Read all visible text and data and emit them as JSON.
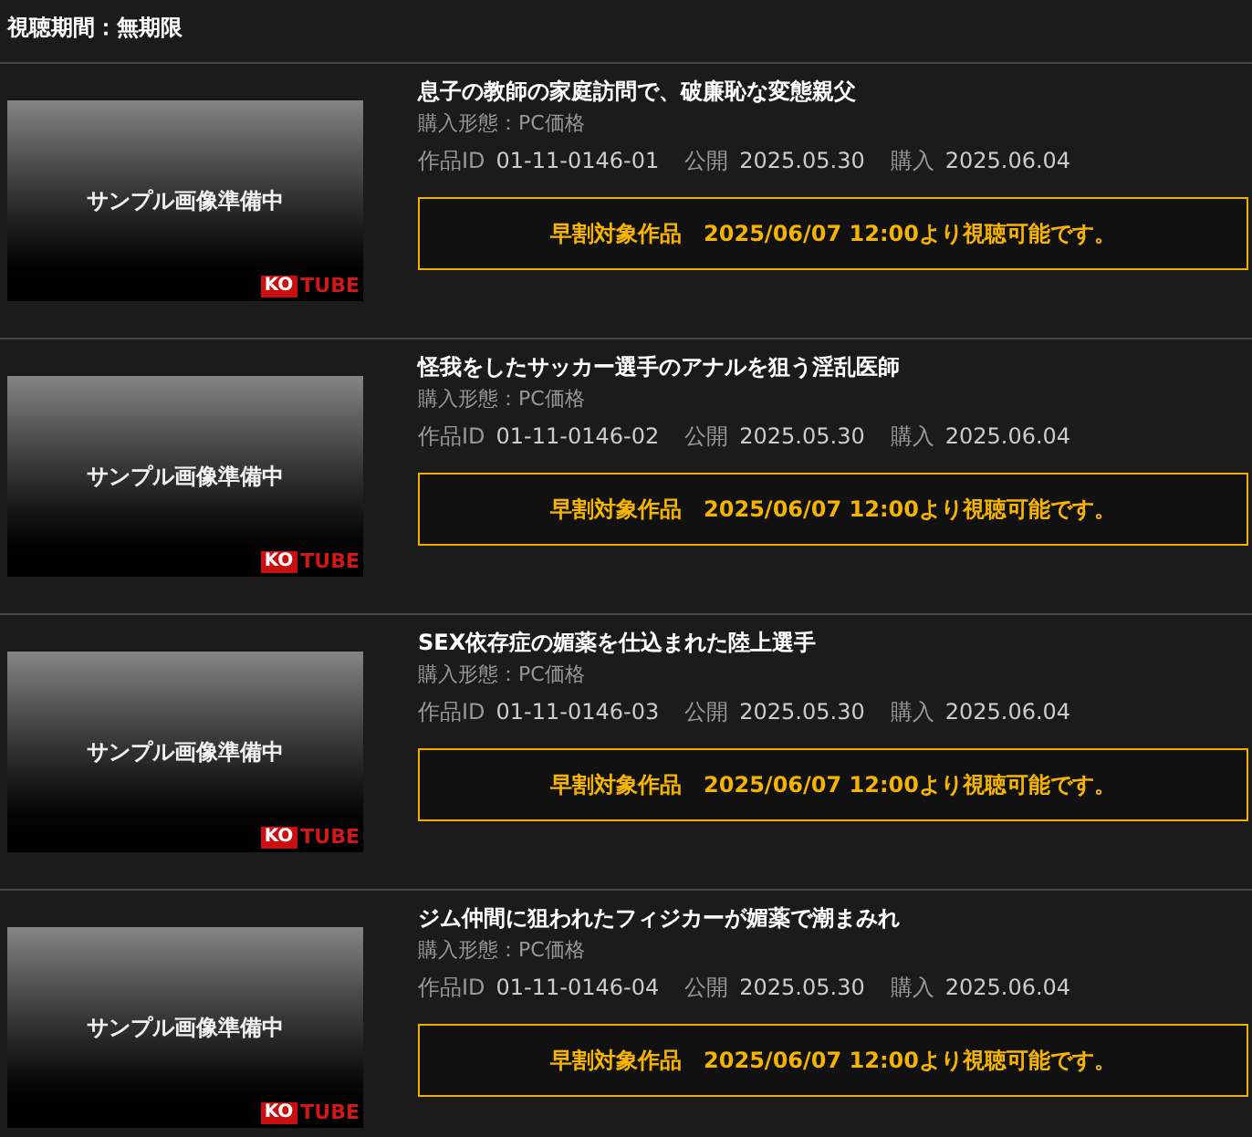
{
  "viewing_period": "視聴期間：無期限",
  "items": [
    {
      "thumbnail": {
        "caption": "サンプル画像準備中",
        "logo_left": "KO",
        "logo_right": "TUBE"
      },
      "title": "息子の教師の家庭訪問で、破廉恥な変態親父",
      "purchase_type": "購入形態：PC価格",
      "id_label": "作品ID",
      "id": "01-11-0146-01",
      "release_label": "公開",
      "release_date": "2025.05.30",
      "purchase_label": "購入",
      "purchase_date": "2025.06.04",
      "notice": "早割対象作品　2025/06/07 12:00より視聴可能です。"
    },
    {
      "thumbnail": {
        "caption": "サンプル画像準備中",
        "logo_left": "KO",
        "logo_right": "TUBE"
      },
      "title": "怪我をしたサッカー選手のアナルを狙う淫乱医師",
      "purchase_type": "購入形態：PC価格",
      "id_label": "作品ID",
      "id": "01-11-0146-02",
      "release_label": "公開",
      "release_date": "2025.05.30",
      "purchase_label": "購入",
      "purchase_date": "2025.06.04",
      "notice": "早割対象作品　2025/06/07 12:00より視聴可能です。"
    },
    {
      "thumbnail": {
        "caption": "サンプル画像準備中",
        "logo_left": "KO",
        "logo_right": "TUBE"
      },
      "title": "SEX依存症の媚薬を仕込まれた陸上選手",
      "purchase_type": "購入形態：PC価格",
      "id_label": "作品ID",
      "id": "01-11-0146-03",
      "release_label": "公開",
      "release_date": "2025.05.30",
      "purchase_label": "購入",
      "purchase_date": "2025.06.04",
      "notice": "早割対象作品　2025/06/07 12:00より視聴可能です。"
    },
    {
      "thumbnail": {
        "caption": "サンプル画像準備中",
        "logo_left": "KO",
        "logo_right": "TUBE"
      },
      "title": "ジム仲間に狙われたフィジカーが媚薬で潮まみれ",
      "purchase_type": "購入形態：PC価格",
      "id_label": "作品ID",
      "id": "01-11-0146-04",
      "release_label": "公開",
      "release_date": "2025.05.30",
      "purchase_label": "購入",
      "purchase_date": "2025.06.04",
      "notice": "早割対象作品　2025/06/07 12:00より視聴可能です。"
    }
  ]
}
